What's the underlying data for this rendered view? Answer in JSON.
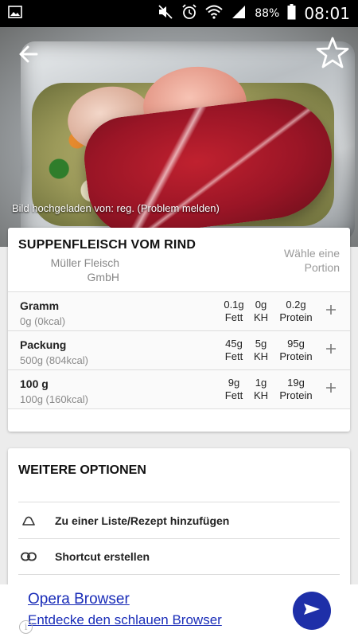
{
  "status_bar": {
    "battery_percent": "88%",
    "time": "08:01",
    "icons": [
      "gallery-icon",
      "mute-icon",
      "alarm-icon",
      "wifi-icon",
      "signal-icon",
      "battery-icon"
    ]
  },
  "hero": {
    "image_credit": "Bild hochgeladen von: reg. (Problem melden)",
    "back_icon": "arrow-left-icon",
    "favorite_icon": "star-outline-icon"
  },
  "product": {
    "title": "SUPPENFLEISCH VOM RIND",
    "brand": "Müller Fleisch GmbH",
    "portion_prompt": "Wähle eine Portion"
  },
  "portions": [
    {
      "name": "Gramm",
      "detail": "0g (0kcal)",
      "fett_value": "0.1g",
      "fett_label": "Fett",
      "kh_value": "0g",
      "kh_label": "KH",
      "protein_value": "0.2g",
      "protein_label": "Protein"
    },
    {
      "name": "Packung",
      "detail": "500g (804kcal)",
      "fett_value": "45g",
      "fett_label": "Fett",
      "kh_value": "5g",
      "kh_label": "KH",
      "protein_value": "95g",
      "protein_label": "Protein"
    },
    {
      "name": "100 g",
      "detail": "100g (160kcal)",
      "fett_value": "9g",
      "fett_label": "Fett",
      "kh_value": "1g",
      "kh_label": "KH",
      "protein_value": "19g",
      "protein_label": "Protein"
    }
  ],
  "options": {
    "title": "WEITERE OPTIONEN",
    "items": [
      {
        "label": "Zu einer Liste/Rezept hinzufügen",
        "icon": "list-add-icon"
      },
      {
        "label": "Shortcut erstellen",
        "icon": "link-icon"
      }
    ]
  },
  "ad": {
    "title": "Opera Browser",
    "subtitle": "Entdecke den schlauen Browser",
    "info_glyph": "i"
  },
  "colors": {
    "ad_link": "#1a2db8",
    "ad_button": "#1e2fa8"
  }
}
